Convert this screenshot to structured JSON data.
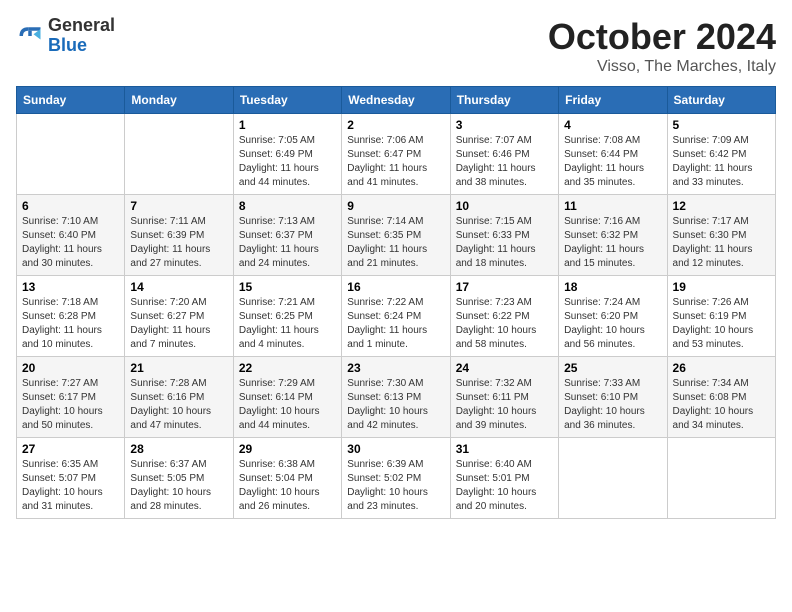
{
  "logo": {
    "general": "General",
    "blue": "Blue"
  },
  "title": "October 2024",
  "location": "Visso, The Marches, Italy",
  "days_of_week": [
    "Sunday",
    "Monday",
    "Tuesday",
    "Wednesday",
    "Thursday",
    "Friday",
    "Saturday"
  ],
  "weeks": [
    [
      {
        "day": "",
        "sunrise": "",
        "sunset": "",
        "daylight": ""
      },
      {
        "day": "",
        "sunrise": "",
        "sunset": "",
        "daylight": ""
      },
      {
        "day": "1",
        "sunrise": "Sunrise: 7:05 AM",
        "sunset": "Sunset: 6:49 PM",
        "daylight": "Daylight: 11 hours and 44 minutes."
      },
      {
        "day": "2",
        "sunrise": "Sunrise: 7:06 AM",
        "sunset": "Sunset: 6:47 PM",
        "daylight": "Daylight: 11 hours and 41 minutes."
      },
      {
        "day": "3",
        "sunrise": "Sunrise: 7:07 AM",
        "sunset": "Sunset: 6:46 PM",
        "daylight": "Daylight: 11 hours and 38 minutes."
      },
      {
        "day": "4",
        "sunrise": "Sunrise: 7:08 AM",
        "sunset": "Sunset: 6:44 PM",
        "daylight": "Daylight: 11 hours and 35 minutes."
      },
      {
        "day": "5",
        "sunrise": "Sunrise: 7:09 AM",
        "sunset": "Sunset: 6:42 PM",
        "daylight": "Daylight: 11 hours and 33 minutes."
      }
    ],
    [
      {
        "day": "6",
        "sunrise": "Sunrise: 7:10 AM",
        "sunset": "Sunset: 6:40 PM",
        "daylight": "Daylight: 11 hours and 30 minutes."
      },
      {
        "day": "7",
        "sunrise": "Sunrise: 7:11 AM",
        "sunset": "Sunset: 6:39 PM",
        "daylight": "Daylight: 11 hours and 27 minutes."
      },
      {
        "day": "8",
        "sunrise": "Sunrise: 7:13 AM",
        "sunset": "Sunset: 6:37 PM",
        "daylight": "Daylight: 11 hours and 24 minutes."
      },
      {
        "day": "9",
        "sunrise": "Sunrise: 7:14 AM",
        "sunset": "Sunset: 6:35 PM",
        "daylight": "Daylight: 11 hours and 21 minutes."
      },
      {
        "day": "10",
        "sunrise": "Sunrise: 7:15 AM",
        "sunset": "Sunset: 6:33 PM",
        "daylight": "Daylight: 11 hours and 18 minutes."
      },
      {
        "day": "11",
        "sunrise": "Sunrise: 7:16 AM",
        "sunset": "Sunset: 6:32 PM",
        "daylight": "Daylight: 11 hours and 15 minutes."
      },
      {
        "day": "12",
        "sunrise": "Sunrise: 7:17 AM",
        "sunset": "Sunset: 6:30 PM",
        "daylight": "Daylight: 11 hours and 12 minutes."
      }
    ],
    [
      {
        "day": "13",
        "sunrise": "Sunrise: 7:18 AM",
        "sunset": "Sunset: 6:28 PM",
        "daylight": "Daylight: 11 hours and 10 minutes."
      },
      {
        "day": "14",
        "sunrise": "Sunrise: 7:20 AM",
        "sunset": "Sunset: 6:27 PM",
        "daylight": "Daylight: 11 hours and 7 minutes."
      },
      {
        "day": "15",
        "sunrise": "Sunrise: 7:21 AM",
        "sunset": "Sunset: 6:25 PM",
        "daylight": "Daylight: 11 hours and 4 minutes."
      },
      {
        "day": "16",
        "sunrise": "Sunrise: 7:22 AM",
        "sunset": "Sunset: 6:24 PM",
        "daylight": "Daylight: 11 hours and 1 minute."
      },
      {
        "day": "17",
        "sunrise": "Sunrise: 7:23 AM",
        "sunset": "Sunset: 6:22 PM",
        "daylight": "Daylight: 10 hours and 58 minutes."
      },
      {
        "day": "18",
        "sunrise": "Sunrise: 7:24 AM",
        "sunset": "Sunset: 6:20 PM",
        "daylight": "Daylight: 10 hours and 56 minutes."
      },
      {
        "day": "19",
        "sunrise": "Sunrise: 7:26 AM",
        "sunset": "Sunset: 6:19 PM",
        "daylight": "Daylight: 10 hours and 53 minutes."
      }
    ],
    [
      {
        "day": "20",
        "sunrise": "Sunrise: 7:27 AM",
        "sunset": "Sunset: 6:17 PM",
        "daylight": "Daylight: 10 hours and 50 minutes."
      },
      {
        "day": "21",
        "sunrise": "Sunrise: 7:28 AM",
        "sunset": "Sunset: 6:16 PM",
        "daylight": "Daylight: 10 hours and 47 minutes."
      },
      {
        "day": "22",
        "sunrise": "Sunrise: 7:29 AM",
        "sunset": "Sunset: 6:14 PM",
        "daylight": "Daylight: 10 hours and 44 minutes."
      },
      {
        "day": "23",
        "sunrise": "Sunrise: 7:30 AM",
        "sunset": "Sunset: 6:13 PM",
        "daylight": "Daylight: 10 hours and 42 minutes."
      },
      {
        "day": "24",
        "sunrise": "Sunrise: 7:32 AM",
        "sunset": "Sunset: 6:11 PM",
        "daylight": "Daylight: 10 hours and 39 minutes."
      },
      {
        "day": "25",
        "sunrise": "Sunrise: 7:33 AM",
        "sunset": "Sunset: 6:10 PM",
        "daylight": "Daylight: 10 hours and 36 minutes."
      },
      {
        "day": "26",
        "sunrise": "Sunrise: 7:34 AM",
        "sunset": "Sunset: 6:08 PM",
        "daylight": "Daylight: 10 hours and 34 minutes."
      }
    ],
    [
      {
        "day": "27",
        "sunrise": "Sunrise: 6:35 AM",
        "sunset": "Sunset: 5:07 PM",
        "daylight": "Daylight: 10 hours and 31 minutes."
      },
      {
        "day": "28",
        "sunrise": "Sunrise: 6:37 AM",
        "sunset": "Sunset: 5:05 PM",
        "daylight": "Daylight: 10 hours and 28 minutes."
      },
      {
        "day": "29",
        "sunrise": "Sunrise: 6:38 AM",
        "sunset": "Sunset: 5:04 PM",
        "daylight": "Daylight: 10 hours and 26 minutes."
      },
      {
        "day": "30",
        "sunrise": "Sunrise: 6:39 AM",
        "sunset": "Sunset: 5:02 PM",
        "daylight": "Daylight: 10 hours and 23 minutes."
      },
      {
        "day": "31",
        "sunrise": "Sunrise: 6:40 AM",
        "sunset": "Sunset: 5:01 PM",
        "daylight": "Daylight: 10 hours and 20 minutes."
      },
      {
        "day": "",
        "sunrise": "",
        "sunset": "",
        "daylight": ""
      },
      {
        "day": "",
        "sunrise": "",
        "sunset": "",
        "daylight": ""
      }
    ]
  ]
}
